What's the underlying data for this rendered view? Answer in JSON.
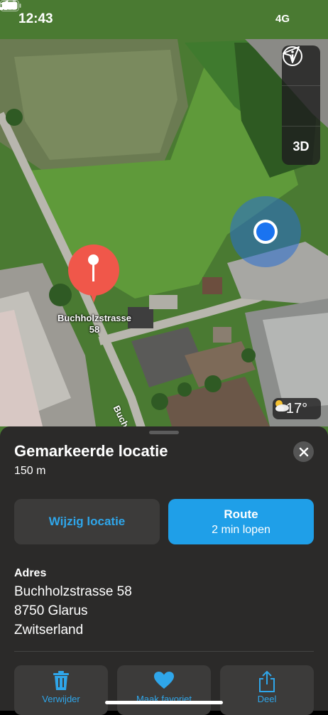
{
  "status": {
    "time": "12:43",
    "network": "4G"
  },
  "map_controls": {
    "info_icon": "info-icon",
    "locate_icon": "location-arrow-icon",
    "mode_label": "3D"
  },
  "pin": {
    "label_line1": "Buchholzstrasse",
    "label_line2": "58"
  },
  "street_label": "Buch",
  "weather": {
    "icon": "partly-cloudy-icon",
    "temperature": "17°"
  },
  "sheet": {
    "title": "Gemarkeerde locatie",
    "distance": "150 m",
    "edit_label": "Wijzig locatie",
    "route_label": "Route",
    "route_sub": "2 min lopen",
    "address_heading": "Adres",
    "address_lines": [
      "Buchholzstrasse 58",
      "8750 Glarus",
      "Zwitserland"
    ],
    "actions": [
      {
        "icon": "trash-icon",
        "label": "Verwijder"
      },
      {
        "icon": "heart-icon",
        "label": "Maak favoriet"
      },
      {
        "icon": "share-icon",
        "label": "Deel"
      }
    ]
  },
  "colors": {
    "accent": "#1f9fe8",
    "pin": "#f0574a",
    "sheet_bg": "#2b2a29"
  }
}
